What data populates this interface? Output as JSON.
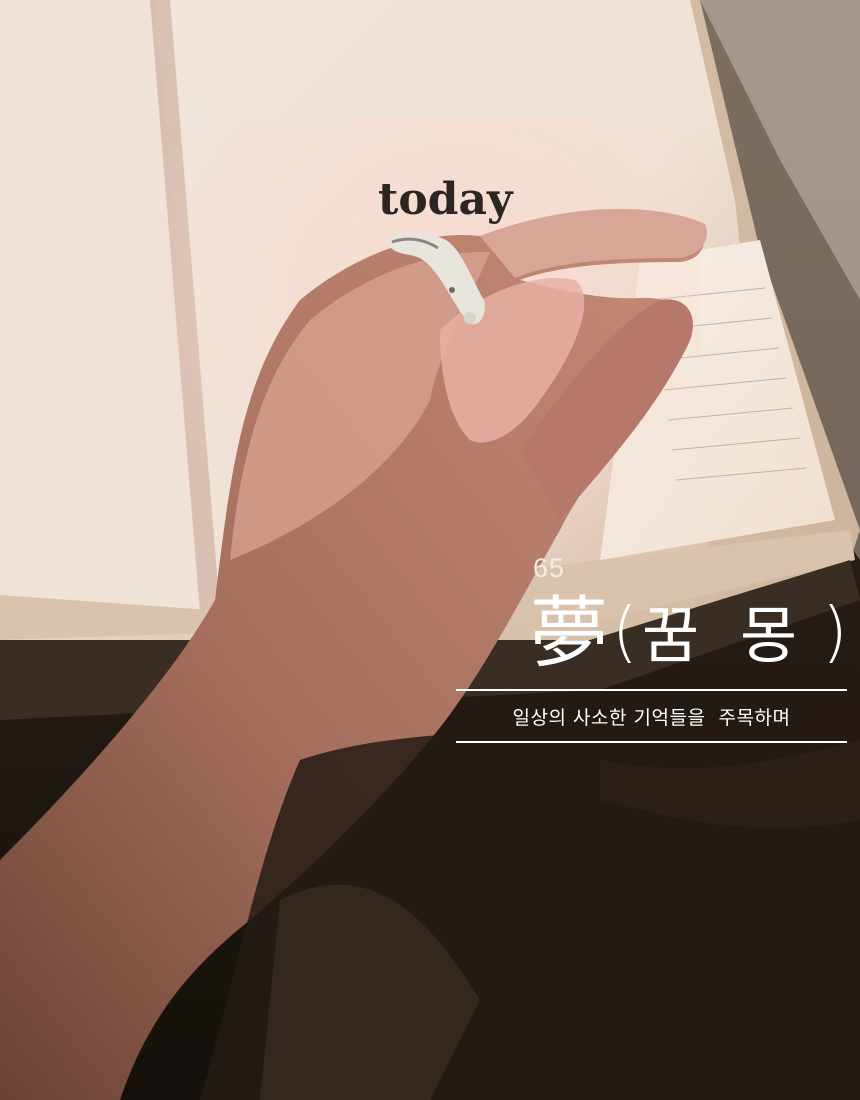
{
  "photo": {
    "book_printed_word": "today",
    "palette": {
      "paper": "#f3e9df",
      "skin": "#c8917e",
      "fabric_dark": "#1f1711",
      "cover": "#e2d0bc"
    }
  },
  "overlay": {
    "number": "65",
    "title_hanja": "夢",
    "title_open_paren": "(",
    "title_korean_1": "꿈",
    "title_korean_2": "몽",
    "title_close_paren": ")",
    "subtitle": "일상의 사소한 기억들을  주목하며"
  }
}
